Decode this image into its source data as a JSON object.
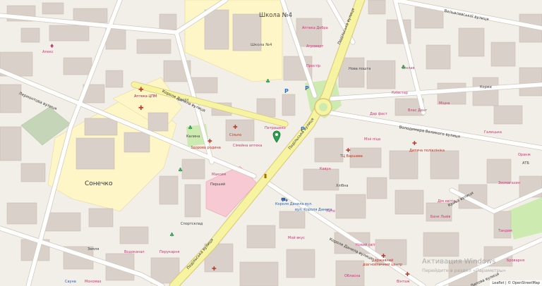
{
  "streets": {
    "lermontova": "Лермонтова вулиця",
    "koroliv_danyla_upper": "Короля Данила вулиця",
    "koroliv_danyla_lower": "Короля Данила вулиця",
    "podilska_upper": "Подільська вулиця",
    "podilska_mid": "Подільська вулиця",
    "podilska_lower": "Подільська вулиця",
    "volodymyra_velykoho": "Володимира Великого вулиця",
    "veleslav": "Вельвлавської вулиця",
    "kryva": "Крива вулиця",
    "lypova": "Липова вулиця"
  },
  "areas": {
    "school4": "Школа №4",
    "school4_small": "Школа №4",
    "sonechko": "Сонечко"
  },
  "pois": {
    "alex": "Алекс",
    "aptech": "Аптека ЦПМ",
    "agrovert": "Агроверт",
    "bukva": "Буква",
    "pivnyk": "Петрашеко",
    "silpo": "Сільпо",
    "zdorova": "Здорова родина",
    "simeyna": "Сімейна аптека",
    "dary_fast": "Дар фаст",
    "tsum": "ТЦ Варшава",
    "apteka_dobr": "Аптека Добра",
    "nova_poshta": "Нова пошта",
    "prostir": "Простір",
    "vynlav": "Вінлав",
    "kyivstar": "Київстар",
    "mini_piz": "Міні піца",
    "dytyacha": "Дитяча поліклініка",
    "hlibna": "Хлібна",
    "kavun": "Кавун",
    "vlas_dental": "Влас Дент",
    "kormy": "Корми",
    "mitsna": "Міцна",
    "galytska": "Галицька",
    "atb": "АТБ",
    "zoomagazyn": "Зоомагазин",
    "bank": "Банк Львів",
    "dim_kvitiv": "Дім квітів",
    "tandem": "Тандем",
    "brovarnya": "Броварня",
    "oblasna": "Обласна",
    "derzh_diagnostic": "Державний діагностичний центр",
    "moy_vkus": "Мой вкус",
    "novyi_svit": "Новий світ",
    "lotto": "Лото",
    "bus_stop": "Короля Данила вул.",
    "avtovokzal": "вул. Короля Данила",
    "maksym": "Максим",
    "pershyi": "Перший",
    "sportsklad": "Спортсклад",
    "vodokanal": "Водоканал",
    "zemlya": "Земля",
    "sauna": "Сауна",
    "monomakh": "Мономах",
    "perukarnya": "Перукарня",
    "oranj": "Оранж",
    "kalyna": "Калина",
    "vintage": "Вінтаж"
  },
  "watermark": {
    "line1": "Активация Windows",
    "line2": "Перейдите в раздел «Параметры»"
  },
  "attribution": "Leaflet | © OpenStreetMap",
  "colors": {
    "background": "#f2efe9",
    "building": "#d9d0c9",
    "building_stroke": "#c8bdb3",
    "school_zone": "#fff6c8",
    "main_road": "#f6f4a1",
    "main_road_casing": "#d8c678",
    "minor_road": "#ffffff",
    "minor_road_casing": "#cfc8bd",
    "park": "#cdebb0",
    "hospital_zone": "#f7c9d2",
    "poi_pink": "#c23b73",
    "pin_green": "#2e9e4f",
    "cemetery_green": "#c5d6b8"
  }
}
